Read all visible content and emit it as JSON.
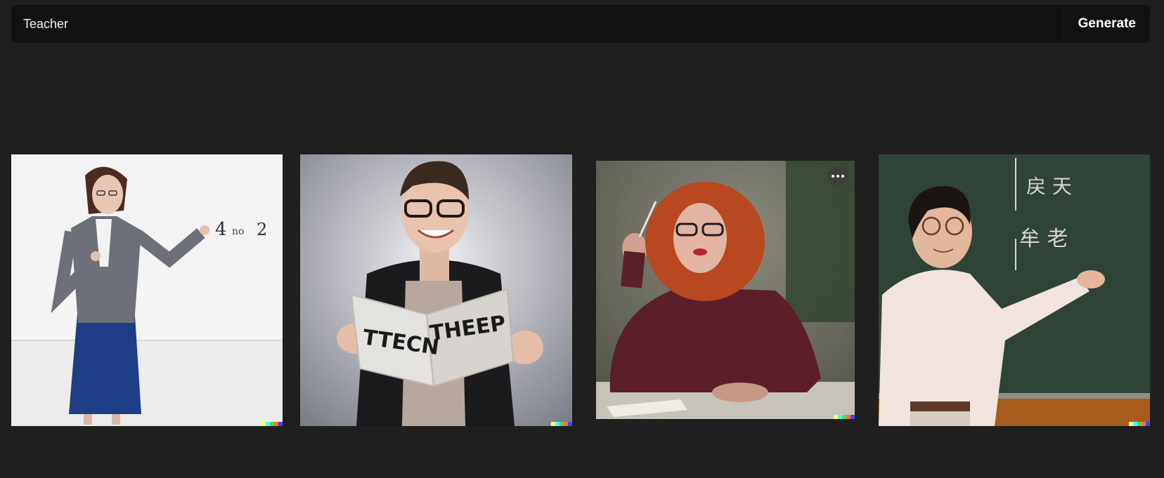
{
  "prompt": {
    "value": "Teacher",
    "generate_label": "Generate"
  },
  "results": [
    {
      "subject": "woman in grey blazer and blue skirt pointing at whiteboard",
      "board_text": [
        "4",
        "no",
        "2"
      ]
    },
    {
      "subject": "smiling woman with glasses holding an open book",
      "book_text": [
        "TTECN",
        "THEEP"
      ]
    },
    {
      "subject": "red-haired woman with glasses holding chalk at desk",
      "menu_icon": "more-horizontal-icon"
    },
    {
      "subject": "man in white shirt presenting at green chalkboard"
    }
  ],
  "colors": {
    "background": "#1f1f1f",
    "prompt_bar": "#121212",
    "signature": [
      "#ffff66",
      "#42ffff",
      "#51da4c",
      "#ff6e3c",
      "#3c46ff"
    ]
  }
}
